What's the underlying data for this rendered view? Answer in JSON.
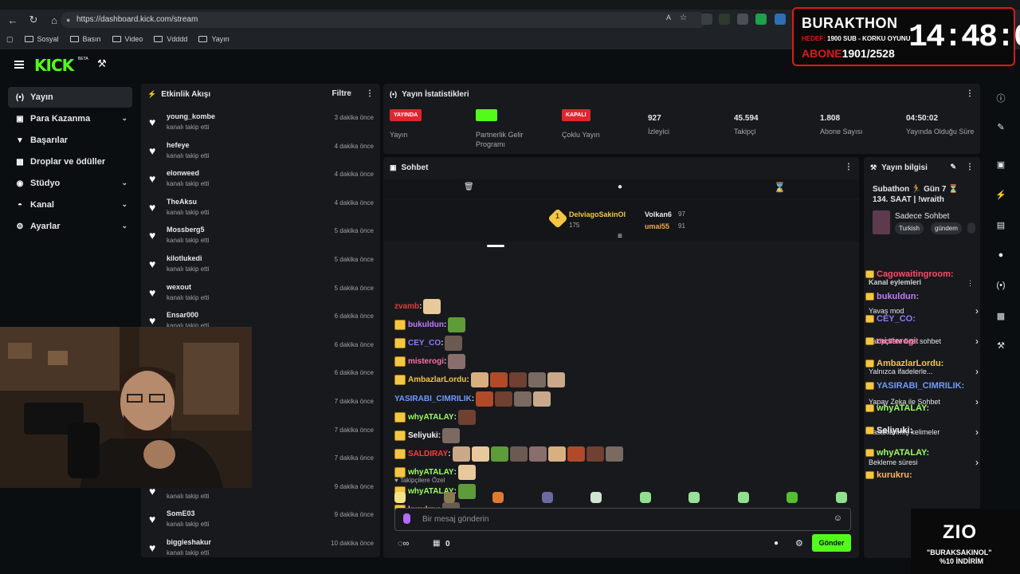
{
  "browser": {
    "url": "https://dashboard.kick.com/stream",
    "bookmarks": [
      "Sosyal",
      "Basın",
      "Video",
      "Vdddd",
      "Yayın"
    ]
  },
  "overlay": {
    "title": "BURAKTHON",
    "goal_label": "HEDEF:",
    "goal_text": "1900 SUB - KORKU OYUNU",
    "sub_label": "ABONE",
    "sub_value": "1901/2528",
    "timer": "14:48:01"
  },
  "app": {
    "logo": "KICK",
    "beta": "BETA"
  },
  "sidebar": {
    "items": [
      {
        "label": "Yayın",
        "icon": "broadcast-icon",
        "active": true,
        "chevron": false
      },
      {
        "label": "Para Kazanma",
        "icon": "money-icon",
        "active": false,
        "chevron": true
      },
      {
        "label": "Başarılar",
        "icon": "trophy-icon",
        "active": false,
        "chevron": false
      },
      {
        "label": "Droplar ve ödüller",
        "icon": "gift-icon",
        "active": false,
        "chevron": false
      },
      {
        "label": "Stüdyo",
        "icon": "studio-icon",
        "active": false,
        "chevron": true
      },
      {
        "label": "Kanal",
        "icon": "channel-icon",
        "active": false,
        "chevron": true
      },
      {
        "label": "Ayarlar",
        "icon": "gear-icon",
        "active": false,
        "chevron": true
      }
    ]
  },
  "activity": {
    "title": "Etkinlik Akışı",
    "filter": "Filtre",
    "rows": [
      {
        "name": "young_kombe",
        "sub": "kanalı takip etti",
        "time": "3 dakika önce"
      },
      {
        "name": "hefeye",
        "sub": "kanalı takip etti",
        "time": "4 dakika önce"
      },
      {
        "name": "elonweed",
        "sub": "kanalı takip etti",
        "time": "4 dakika önce"
      },
      {
        "name": "TheAksu",
        "sub": "kanalı takip etti",
        "time": "4 dakika önce"
      },
      {
        "name": "Mossberg5",
        "sub": "kanalı takip etti",
        "time": "5 dakika önce"
      },
      {
        "name": "kilotlukedi",
        "sub": "kanalı takip etti",
        "time": "5 dakika önce"
      },
      {
        "name": "wexout",
        "sub": "kanalı takip etti",
        "time": "5 dakika önce"
      },
      {
        "name": "Ensar000",
        "sub": "kanalı takip etti",
        "time": "6 dakika önce"
      },
      {
        "name": "",
        "sub": "",
        "time": "6 dakika önce"
      },
      {
        "name": "",
        "sub": "",
        "time": "6 dakika önce"
      },
      {
        "name": "",
        "sub": "",
        "time": "7 dakika önce"
      },
      {
        "name": "",
        "sub": "",
        "time": "7 dakika önce"
      },
      {
        "name": "",
        "sub": "",
        "time": "7 dakika önce"
      },
      {
        "name": "ntidreocido22",
        "sub": "kanalı takip etti",
        "time": "9 dakika önce"
      },
      {
        "name": "SomE03",
        "sub": "kanalı takip etti",
        "time": "9 dakika önce"
      },
      {
        "name": "biggieshakur",
        "sub": "kanalı takip etti",
        "time": "10 dakika önce"
      }
    ]
  },
  "stats": {
    "title": "Yayın İstatistikleri",
    "items": [
      {
        "badge": "YAYINDA",
        "badge_color": "#e0262d",
        "label": "Yayın"
      },
      {
        "badge": "AÇIK",
        "badge_color": "#53fc18",
        "label": "Partnerlik Gelir Programı"
      },
      {
        "badge": "KAPALI",
        "badge_color": "#e0262d",
        "label": "Çoklu Yayın"
      },
      {
        "value": "927",
        "label": "İzleyici"
      },
      {
        "value": "45.594",
        "label": "Takipçi"
      },
      {
        "value": "1.808",
        "label": "Abone Sayısı"
      },
      {
        "value": "04:50:02",
        "label": "Yayında Olduğu Süre"
      }
    ]
  },
  "chat": {
    "title": "Sohbet",
    "top": {
      "rank": "1",
      "first_name": "DelviagoSakinOl",
      "first_score": "175",
      "second_name": "Volkan6",
      "second_score": "97",
      "third_name": "umai55",
      "third_score": "91"
    },
    "messages": [
      {
        "user": "zvamb",
        "color": "#e23b3b",
        "badge": false,
        "emotes": 1
      },
      {
        "user": "bukuldun",
        "color": "#c27cff",
        "badge": true,
        "emotes": 1
      },
      {
        "user": "CEY_CO",
        "color": "#8a7cff",
        "badge": true,
        "emotes": 1
      },
      {
        "user": "misterogi",
        "color": "#ff6fae",
        "badge": true,
        "emotes": 1
      },
      {
        "user": "AmbazlarLordu",
        "color": "#f3c744",
        "badge": true,
        "emotes": 5
      },
      {
        "user": "YASIRABI_CIMRILIK",
        "color": "#6f9bff",
        "badge": false,
        "emotes": 4
      },
      {
        "user": "whyATALAY",
        "color": "#9aff5e",
        "badge": true,
        "emotes": 1
      },
      {
        "user": "Seliyuki",
        "color": "#f5f5f5",
        "badge": true,
        "emotes": 1
      },
      {
        "user": "SALDIRAY",
        "color": "#ff3b3b",
        "badge": true,
        "emotes": 9
      },
      {
        "user": "whyATALAY",
        "color": "#9aff5e",
        "badge": true,
        "emotes": 1
      },
      {
        "user": "whyATALAY",
        "color": "#9aff5e",
        "badge": true,
        "emotes": 1
      },
      {
        "user": "kurukru",
        "color": "#ffb85e",
        "badge": true,
        "emotes": 1
      }
    ],
    "follower_only": "Takipçilere Özel",
    "placeholder": "Bir mesaj gönderin",
    "count": "0",
    "send": "Gönder"
  },
  "info": {
    "title": "Yayın bilgisi",
    "stream_title": "Subathon 🏃 Gün 7 ⏳ 134. SAAT | !wraith",
    "category": "Sadece Sohbet",
    "tags": [
      "Turkish",
      "gündem"
    ],
    "chat_overlay": [
      {
        "user": "Cagowaitingroom:",
        "color": "#ff4a6a"
      },
      {
        "user": "bukuldun:",
        "color": "#c27cff"
      },
      {
        "user": "CEY_CO:",
        "color": "#8a7cff"
      },
      {
        "user": "misterogi:",
        "color": "#ff6fae"
      },
      {
        "user": "AmbazlarLordu:",
        "color": "#f3c744"
      },
      {
        "user": "YASIRABI_CIMRILIK:",
        "color": "#6f9bff"
      },
      {
        "user": "whyATALAY:",
        "color": "#9aff5e"
      },
      {
        "user": "Seliyuki:",
        "color": "#f5f5f5"
      },
      {
        "user": "whyATALAY:",
        "color": "#9aff5e"
      },
      {
        "user": "kurukru:",
        "color": "#ffb85e"
      }
    ],
    "mod_title": "Kanal eylemleri",
    "items": [
      "Yavaş mod",
      "Takipçilere özel sohbet",
      "Yalnızca ifadelerle...",
      "Yapay Zeka ile Sohbet",
      "Yasaklanmış kelimeler",
      "Bekleme süresi"
    ]
  },
  "sponsor": {
    "brand": "ZIO",
    "line1": "\"BURAKSAKINOL\"",
    "line2": "%10 İNDİRİM"
  }
}
